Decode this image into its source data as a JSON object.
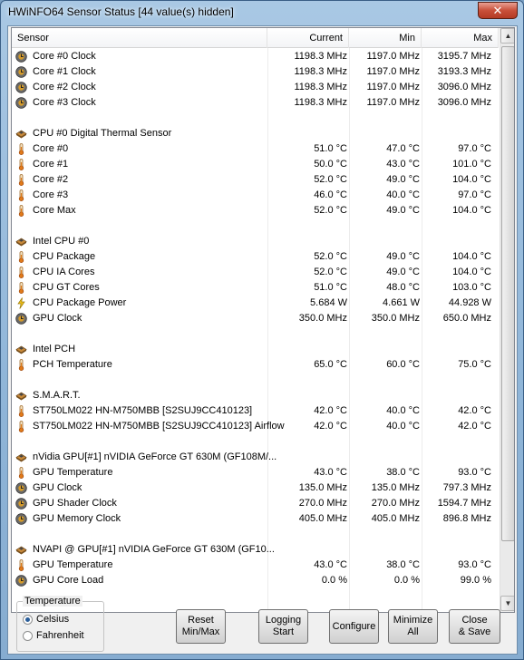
{
  "window": {
    "title": "HWiNFO64 Sensor Status [44 value(s) hidden]",
    "close_glyph": "✕"
  },
  "columns": {
    "sensor": "Sensor",
    "current": "Current",
    "min": "Min",
    "max": "Max"
  },
  "rows": [
    {
      "icon": "clock",
      "name": "Core #0 Clock",
      "current": "1198.3 MHz",
      "min": "1197.0 MHz",
      "max": "3195.7 MHz"
    },
    {
      "icon": "clock",
      "name": "Core #1 Clock",
      "current": "1198.3 MHz",
      "min": "1197.0 MHz",
      "max": "3193.3 MHz"
    },
    {
      "icon": "clock",
      "name": "Core #2 Clock",
      "current": "1198.3 MHz",
      "min": "1197.0 MHz",
      "max": "3096.0 MHz"
    },
    {
      "icon": "clock",
      "name": "Core #3 Clock",
      "current": "1198.3 MHz",
      "min": "1197.0 MHz",
      "max": "3096.0 MHz"
    },
    {
      "icon": "blank",
      "name": "",
      "current": "",
      "min": "",
      "max": ""
    },
    {
      "icon": "chip",
      "name": "CPU #0 Digital Thermal Sensor",
      "current": "",
      "min": "",
      "max": ""
    },
    {
      "icon": "thermometer",
      "name": "Core #0",
      "current": "51.0 °C",
      "min": "47.0 °C",
      "max": "97.0 °C"
    },
    {
      "icon": "thermometer",
      "name": "Core #1",
      "current": "50.0 °C",
      "min": "43.0 °C",
      "max": "101.0 °C"
    },
    {
      "icon": "thermometer",
      "name": "Core #2",
      "current": "52.0 °C",
      "min": "49.0 °C",
      "max": "104.0 °C"
    },
    {
      "icon": "thermometer",
      "name": "Core #3",
      "current": "46.0 °C",
      "min": "40.0 °C",
      "max": "97.0 °C"
    },
    {
      "icon": "thermometer",
      "name": "Core Max",
      "current": "52.0 °C",
      "min": "49.0 °C",
      "max": "104.0 °C"
    },
    {
      "icon": "blank",
      "name": "",
      "current": "",
      "min": "",
      "max": ""
    },
    {
      "icon": "chip",
      "name": "Intel CPU #0",
      "current": "",
      "min": "",
      "max": ""
    },
    {
      "icon": "thermometer",
      "name": "CPU Package",
      "current": "52.0 °C",
      "min": "49.0 °C",
      "max": "104.0 °C"
    },
    {
      "icon": "thermometer",
      "name": "CPU IA Cores",
      "current": "52.0 °C",
      "min": "49.0 °C",
      "max": "104.0 °C"
    },
    {
      "icon": "thermometer",
      "name": "CPU GT Cores",
      "current": "51.0 °C",
      "min": "48.0 °C",
      "max": "103.0 °C"
    },
    {
      "icon": "power",
      "name": "CPU Package Power",
      "current": "5.684 W",
      "min": "4.661 W",
      "max": "44.928 W"
    },
    {
      "icon": "clock",
      "name": "GPU Clock",
      "current": "350.0 MHz",
      "min": "350.0 MHz",
      "max": "650.0 MHz"
    },
    {
      "icon": "blank",
      "name": "",
      "current": "",
      "min": "",
      "max": ""
    },
    {
      "icon": "chip",
      "name": "Intel PCH",
      "current": "",
      "min": "",
      "max": ""
    },
    {
      "icon": "thermometer",
      "name": "PCH Temperature",
      "current": "65.0 °C",
      "min": "60.0 °C",
      "max": "75.0 °C"
    },
    {
      "icon": "blank",
      "name": "",
      "current": "",
      "min": "",
      "max": ""
    },
    {
      "icon": "chip",
      "name": "S.M.A.R.T.",
      "current": "",
      "min": "",
      "max": ""
    },
    {
      "icon": "thermometer",
      "name": "ST750LM022 HN-M750MBB [S2SUJ9CC410123]",
      "current": "42.0 °C",
      "min": "40.0 °C",
      "max": "42.0 °C"
    },
    {
      "icon": "thermometer",
      "name": "ST750LM022 HN-M750MBB [S2SUJ9CC410123] Airflow",
      "current": "42.0 °C",
      "min": "40.0 °C",
      "max": "42.0 °C"
    },
    {
      "icon": "blank",
      "name": "",
      "current": "",
      "min": "",
      "max": ""
    },
    {
      "icon": "chip",
      "name": "nVidia GPU[#1] nVIDIA GeForce GT 630M (GF108M/...",
      "current": "",
      "min": "",
      "max": ""
    },
    {
      "icon": "thermometer",
      "name": "GPU Temperature",
      "current": "43.0 °C",
      "min": "38.0 °C",
      "max": "93.0 °C"
    },
    {
      "icon": "clock",
      "name": "GPU Clock",
      "current": "135.0 MHz",
      "min": "135.0 MHz",
      "max": "797.3 MHz"
    },
    {
      "icon": "clock",
      "name": "GPU Shader Clock",
      "current": "270.0 MHz",
      "min": "270.0 MHz",
      "max": "1594.7 MHz"
    },
    {
      "icon": "clock",
      "name": "GPU Memory Clock",
      "current": "405.0 MHz",
      "min": "405.0 MHz",
      "max": "896.8 MHz"
    },
    {
      "icon": "blank",
      "name": "",
      "current": "",
      "min": "",
      "max": ""
    },
    {
      "icon": "chip",
      "name": "NVAPI @ GPU[#1] nVIDIA GeForce GT 630M (GF10...",
      "current": "",
      "min": "",
      "max": ""
    },
    {
      "icon": "thermometer",
      "name": "GPU Temperature",
      "current": "43.0 °C",
      "min": "38.0 °C",
      "max": "93.0 °C"
    },
    {
      "icon": "clock",
      "name": "GPU Core Load",
      "current": "0.0 %",
      "min": "0.0 %",
      "max": "99.0 %"
    }
  ],
  "scrollbar": {
    "up_glyph": "▲",
    "down_glyph": "▼"
  },
  "temperature": {
    "label": "Temperature",
    "options": [
      "Celsius",
      "Fahrenheit"
    ],
    "selected": "Celsius"
  },
  "buttons": {
    "reset": "Reset\nMin/Max",
    "logging": "Logging\nStart",
    "configure": "Configure",
    "minimize": "Minimize\nAll",
    "close": "Close\n& Save"
  }
}
